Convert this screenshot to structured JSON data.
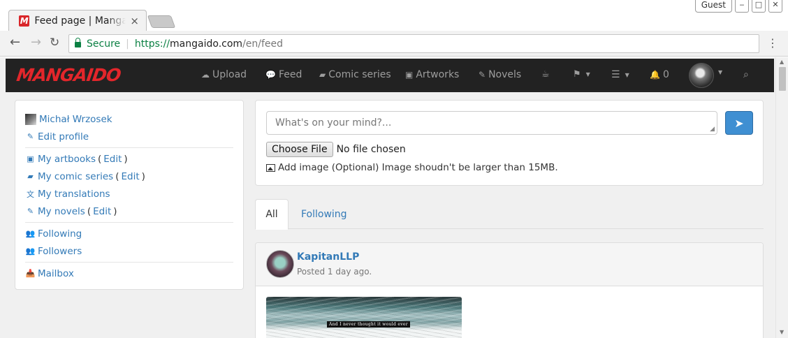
{
  "browser": {
    "tab_title": "Feed page | Mangaido",
    "tab_close": "×",
    "profile_label": "Guest",
    "url_secure_label": "Secure",
    "url_scheme": "https://",
    "url_host": "mangaido.com",
    "url_path": "/en/feed"
  },
  "site": {
    "brand": "MANGAIDO",
    "brand_color": "#e3262b",
    "nav": {
      "upload": "Upload",
      "feed": "Feed",
      "comic_series": "Comic series",
      "artworks": "Artworks",
      "novels": "Novels",
      "notifications_count": "0"
    }
  },
  "sidebar": {
    "user_name": "Michał Wrzosek",
    "edit_profile": "Edit profile",
    "my_artbooks": "My artbooks",
    "my_comic_series": "My comic series",
    "my_translations": "My translations",
    "my_novels": "My novels",
    "edit": "Edit",
    "open_paren": "(",
    "close_paren": ")",
    "following": "Following",
    "followers": "Followers",
    "mailbox": "Mailbox"
  },
  "compose": {
    "placeholder": "What's on your mind?...",
    "choose_file": "Choose File",
    "no_file": "No file chosen",
    "hint": "Add image (Optional) Image shoudn't be larger than 15MB."
  },
  "feed_tabs": {
    "all": "All",
    "following": "Following"
  },
  "post": {
    "author": "KapitanLLP",
    "time": "Posted 1 day ago.",
    "image_caption": "And I never thought it would ever"
  }
}
